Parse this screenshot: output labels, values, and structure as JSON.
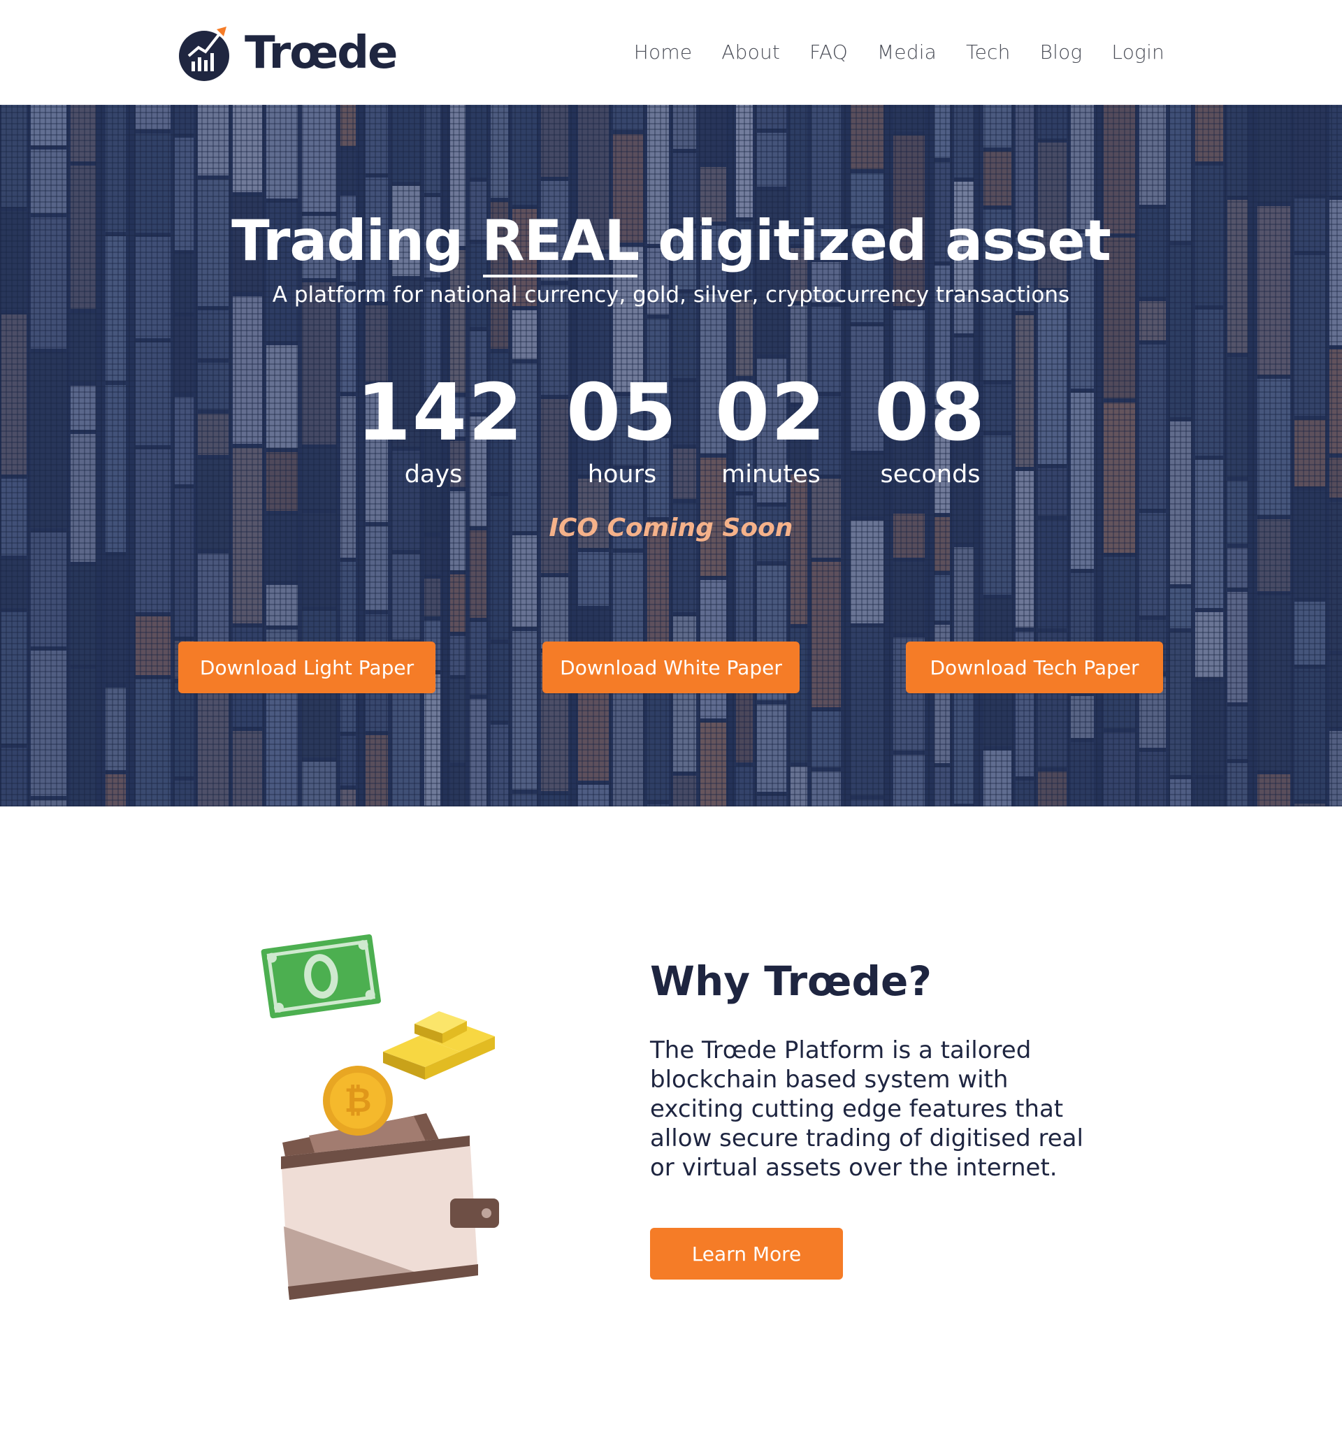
{
  "brand": {
    "name": "Trœde",
    "accent": "#f57c27",
    "navy": "#1f2640"
  },
  "nav": [
    {
      "label": "Home"
    },
    {
      "label": "About"
    },
    {
      "label": "FAQ"
    },
    {
      "label": "Media"
    },
    {
      "label": "Tech"
    },
    {
      "label": "Blog"
    },
    {
      "label": "Login"
    }
  ],
  "hero": {
    "title_pre": "Trading ",
    "title_emph": "REAL",
    "title_post": " digitized asset",
    "subtitle": "A platform for national currency, gold, silver, cryptocurrency transactions",
    "countdown": {
      "days": {
        "value": "142",
        "label": "days"
      },
      "hours": {
        "value": "05",
        "label": "hours"
      },
      "minutes": {
        "value": "02",
        "label": "minutes"
      },
      "seconds": {
        "value": "08",
        "label": "seconds"
      }
    },
    "ico_text": "ICO Coming Soon",
    "buttons": {
      "light": "Download Light Paper",
      "white": "Download White Paper",
      "tech": "Download Tech Paper"
    }
  },
  "why": {
    "title": "Why Trœde?",
    "text": "The Trœde Platform is a tailored blockchain based system with exciting cutting edge features that allow secure trading of digitised real or virtual assets over the internet.",
    "button": "Learn More"
  },
  "icons": {
    "logo": "chart-growth-icon",
    "illustration": [
      "banknote-icon",
      "gold-bars-icon",
      "bitcoin-coin-icon",
      "wallet-icon"
    ]
  }
}
